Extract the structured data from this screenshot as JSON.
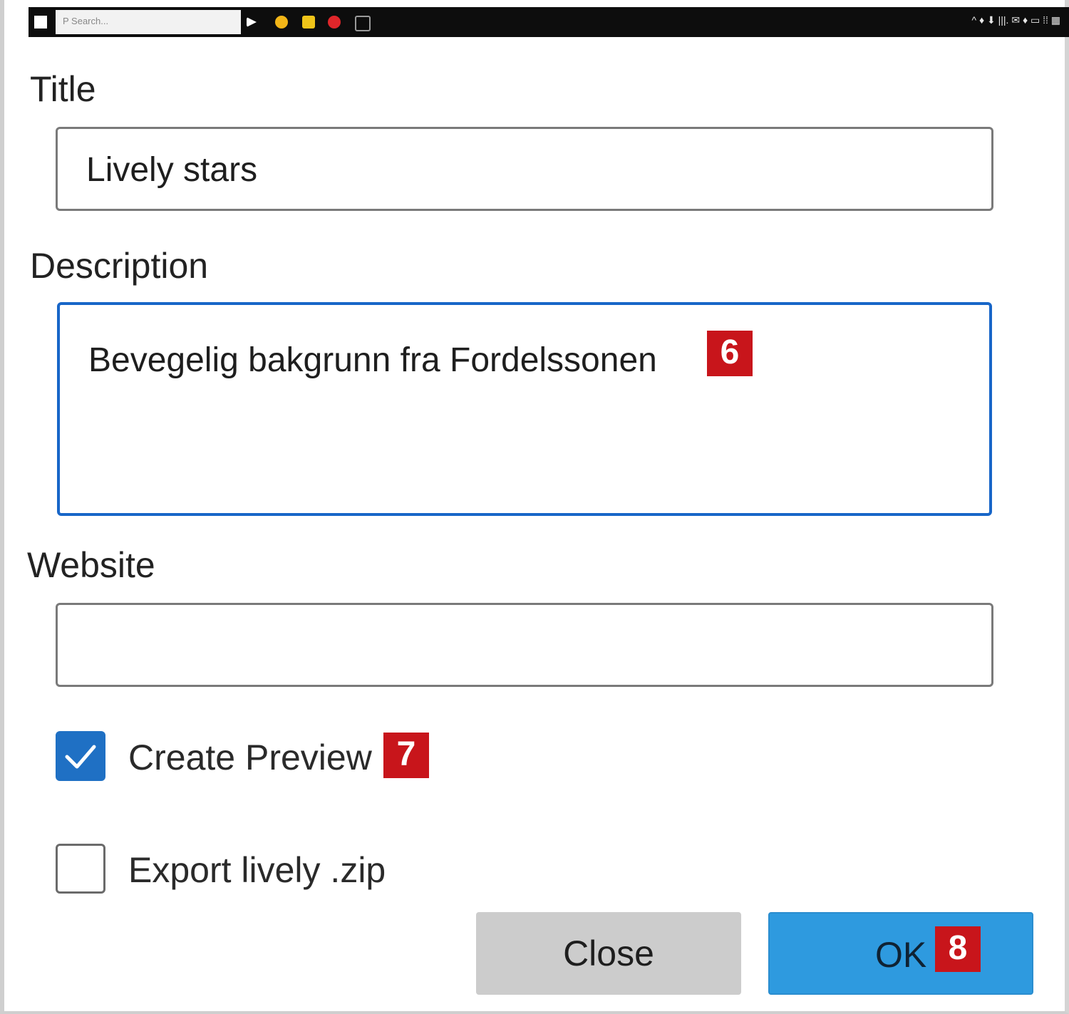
{
  "taskbar": {
    "search_placeholder": "P Search...",
    "tray_text": "^ ♦ ⬇ |||. ✉ ♦ ▭ ⁞⁞ ▦"
  },
  "form": {
    "title_label": "Title",
    "title_value": "Lively stars",
    "description_label": "Description",
    "description_value": "Bevegelig bakgrunn fra Fordelssonen",
    "website_label": "Website",
    "website_value": "",
    "create_preview_label": "Create Preview",
    "create_preview_checked": true,
    "export_zip_label": "Export lively .zip",
    "export_zip_checked": false
  },
  "buttons": {
    "close_label": "Close",
    "ok_label": "OK"
  },
  "badges": {
    "description": "6",
    "create_preview": "7",
    "ok": "8"
  },
  "colors": {
    "accent_blue": "#1f70c4",
    "ok_button": "#2e9adf",
    "badge_red": "#c8151b",
    "focus_border": "#1866c8"
  }
}
